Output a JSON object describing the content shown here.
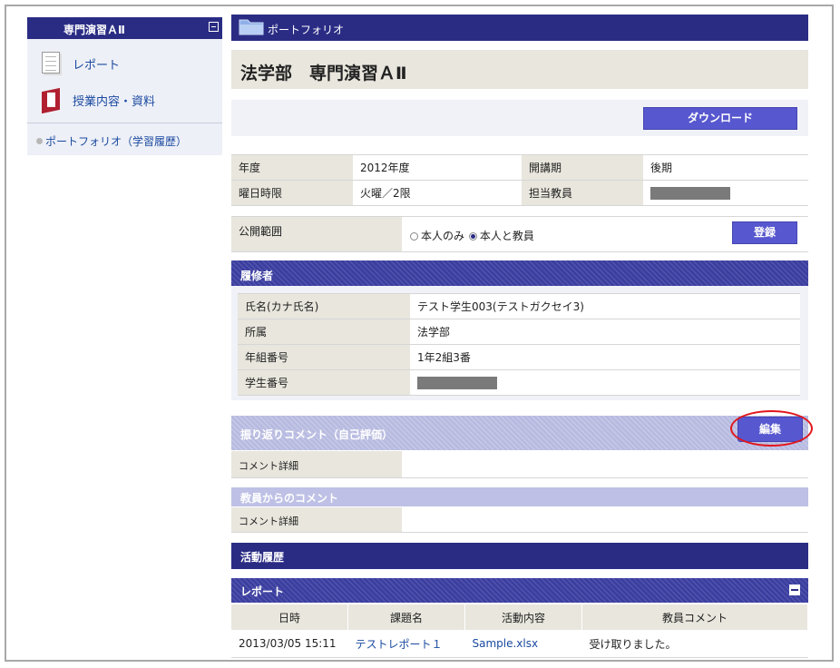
{
  "sidebar": {
    "header": "専門演習ＡⅡ",
    "items": [
      {
        "label": "レポート",
        "icon": "document-icon"
      },
      {
        "label": "授業内容・資料",
        "icon": "book-icon"
      }
    ],
    "portfolio_link": "ポートフォリオ（学習履歴）"
  },
  "header": {
    "section": "ポートフォリオ",
    "title": "法学部　専門演習ＡⅡ"
  },
  "download_button": "ダウンロード",
  "course_info": {
    "year_label": "年度",
    "year": "2012年度",
    "term_label": "開講期",
    "term": "後期",
    "period_label": "曜日時限",
    "period": "火曜／2限",
    "teacher_label": "担当教員"
  },
  "visibility": {
    "label": "公開範囲",
    "options": [
      "本人のみ",
      "本人と教員"
    ],
    "selected": "本人と教員",
    "register_button": "登録"
  },
  "student": {
    "section": "履修者",
    "name_label": "氏名(カナ氏名)",
    "name": "テスト学生003(テストガクセイ3)",
    "dept_label": "所属",
    "dept": "法学部",
    "class_label": "年組番号",
    "class": "1年2組3番",
    "id_label": "学生番号"
  },
  "reflection": {
    "section": "振り返りコメント（自己評価）",
    "edit_button": "編集",
    "detail_label": "コメント詳細",
    "detail": ""
  },
  "teacher_comment": {
    "section": "教員からのコメント",
    "detail_label": "コメント詳細",
    "detail": ""
  },
  "activity": {
    "section": "活動履歴",
    "report_section": "レポート",
    "columns": [
      "日時",
      "課題名",
      "活動内容",
      "教員コメント"
    ],
    "rows": [
      {
        "date": "2013/03/05 15:11",
        "task": "テストレポート１",
        "content": "Sample.xlsx",
        "comment": "受け取りました。"
      }
    ]
  },
  "colors": {
    "navy": "#2a2c84",
    "button": "#5757cf",
    "label_bg": "#e8e6dd",
    "highlight_ring": "#e2151b"
  }
}
